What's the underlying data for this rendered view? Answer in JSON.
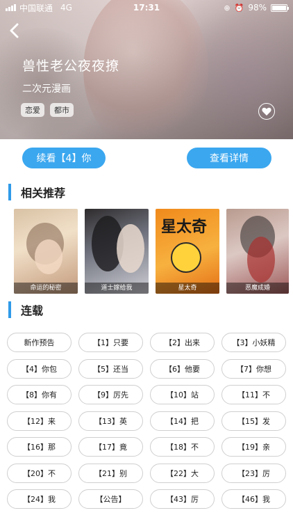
{
  "status_bar": {
    "carrier": "中国联通",
    "network": "4G",
    "time": "17:31",
    "battery_percent": "98%",
    "battery_level": 0.98
  },
  "header": {
    "title": "兽性老公夜夜撩",
    "subtitle": "二次元漫画",
    "tags": [
      "恋爱",
      "都市"
    ],
    "back_icon": "chevron-left-icon",
    "favorite_icon": "heart-icon"
  },
  "actions": {
    "continue_label": "续看【4】你",
    "detail_label": "查看详情",
    "accent_color": "#3ba7ef"
  },
  "recommendations": {
    "title": "相关推荐",
    "items": [
      {
        "label": "命运的秘密"
      },
      {
        "label": "道士嫁给我"
      },
      {
        "label": "星太奇",
        "cover_text": "星太奇"
      },
      {
        "label": "恶魔成婚"
      }
    ]
  },
  "serial": {
    "title": "连载",
    "chapters": [
      "新作预告",
      "【1】只要",
      "【2】出来",
      "【3】小妖精",
      "【4】你包",
      "【5】还当",
      "【6】他要",
      "【7】你想",
      "【8】你有",
      "【9】厉先",
      "【10】站",
      "【11】不",
      "【12】来",
      "【13】英",
      "【14】把",
      "【15】发",
      "【16】那",
      "【17】竟",
      "【18】不",
      "【19】亲",
      "【20】不",
      "【21】别",
      "【22】大",
      "【23】厉",
      "【24】我",
      "【公告】",
      "【43】厉",
      "【46】我"
    ]
  }
}
